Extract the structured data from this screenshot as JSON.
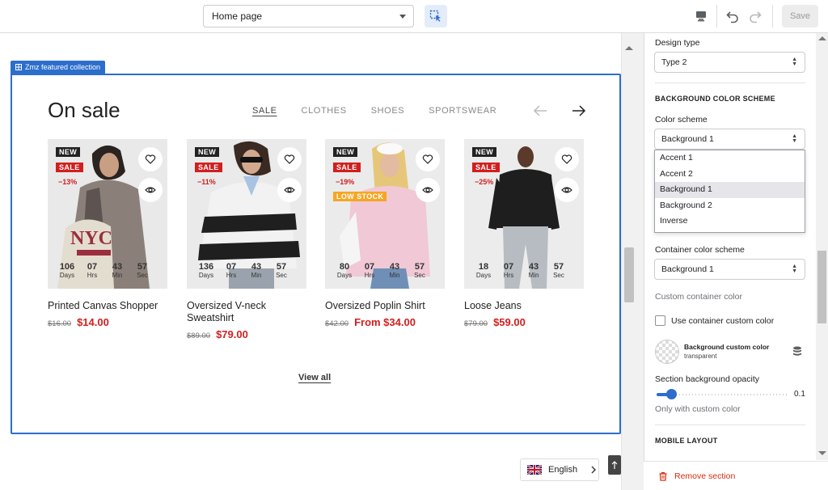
{
  "topbar": {
    "page_select": "Home page",
    "save_label": "Save"
  },
  "section": {
    "tag": "Zmz featured collection",
    "title": "On sale",
    "tabs": [
      {
        "label": "SALE",
        "active": true
      },
      {
        "label": "CLOTHES",
        "active": false
      },
      {
        "label": "SHOES",
        "active": false
      },
      {
        "label": "SPORTSWEAR",
        "active": false
      }
    ],
    "view_all": "View all"
  },
  "products": [
    {
      "name": "Printed Canvas Shopper",
      "old_price": "$16.00",
      "price": "$14.00",
      "badges": [
        "NEW",
        "SALE"
      ],
      "discount": "−13%",
      "low_stock": "",
      "countdown": {
        "days": "106",
        "hrs": "07",
        "min": "43",
        "sec": "57"
      }
    },
    {
      "name": "Oversized V-neck Sweatshirt",
      "old_price": "$89.00",
      "price": "$79.00",
      "badges": [
        "NEW",
        "SALE"
      ],
      "discount": "−11%",
      "low_stock": "",
      "countdown": {
        "days": "136",
        "hrs": "07",
        "min": "43",
        "sec": "57"
      }
    },
    {
      "name": "Oversized Poplin Shirt",
      "old_price": "$42.00",
      "price": "From $34.00",
      "badges": [
        "NEW",
        "SALE"
      ],
      "discount": "−19%",
      "low_stock": "LOW STOCK",
      "countdown": {
        "days": "80",
        "hrs": "07",
        "min": "43",
        "sec": "57"
      }
    },
    {
      "name": "Loose Jeans",
      "old_price": "$79.00",
      "price": "$59.00",
      "badges": [
        "NEW",
        "SALE"
      ],
      "discount": "−25%",
      "low_stock": "",
      "countdown": {
        "days": "18",
        "hrs": "07",
        "min": "43",
        "sec": "57"
      }
    }
  ],
  "countdown_units": {
    "days": "Days",
    "hrs": "Hrs",
    "min": "Min",
    "sec": "Sec"
  },
  "language": "English",
  "panel": {
    "design_type_label": "Design type",
    "design_type_value": "Type 2",
    "bg_scheme_heading": "BACKGROUND COLOR SCHEME",
    "color_scheme_label": "Color scheme",
    "color_scheme_value": "Background 1",
    "color_scheme_options": [
      "Accent 1",
      "Accent 2",
      "Background 1",
      "Background 2",
      "Inverse"
    ],
    "container_scheme_label": "Container color scheme",
    "container_scheme_value": "Background 1",
    "custom_container_label": "Custom container color",
    "use_custom_label": "Use container custom color",
    "bg_custom_color_label": "Background custom color",
    "bg_custom_color_value": "transparent",
    "opacity_label": "Section background opacity",
    "opacity_value": "0.1",
    "opacity_hint": "Only with custom color",
    "mobile_heading": "MOBILE LAYOUT",
    "remove_label": "Remove section"
  },
  "colors": {
    "accent": "#2c6ecb",
    "sale": "#d11f1f",
    "low_stock": "#f5a623",
    "danger": "#d72c0d"
  }
}
